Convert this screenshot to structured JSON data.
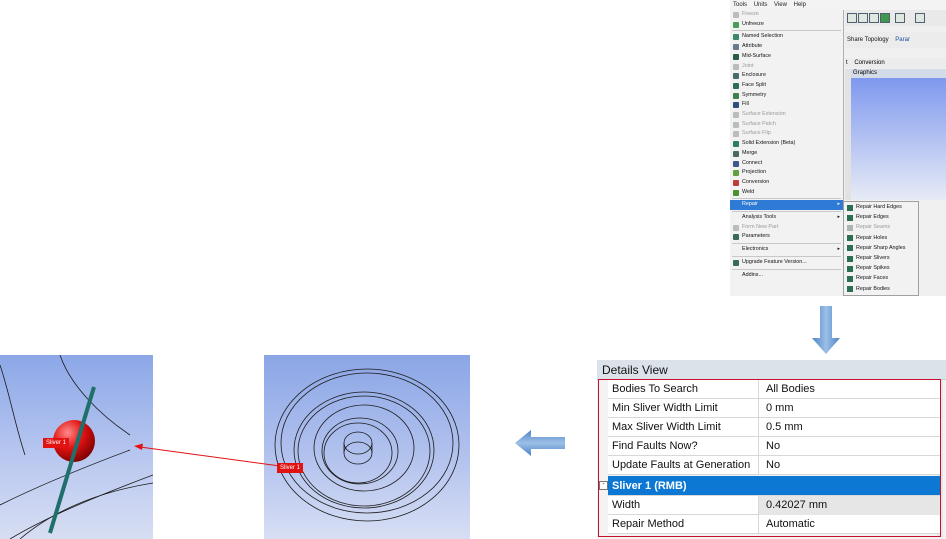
{
  "menu_screenshot": {
    "menubar": [
      "Tools",
      "Units",
      "View",
      "Help"
    ],
    "toolbar_text": "Share Topology",
    "toolbar_text2": "Parar",
    "tab_prefix": "t",
    "tab_conversion": "Conversion",
    "graphics_tab": "Graphics",
    "tools_menu": [
      {
        "label": "Freeze",
        "disabled": true,
        "icon": "freeze-icon"
      },
      {
        "label": "Unfreeze",
        "disabled": false,
        "icon": "unfreeze-icon"
      },
      {
        "label": "Named Selection",
        "disabled": false,
        "icon": "named-selection-icon"
      },
      {
        "label": "Attribute",
        "disabled": false,
        "icon": "attribute-icon"
      },
      {
        "label": "Mid-Surface",
        "disabled": false,
        "icon": "mid-surface-icon"
      },
      {
        "label": "Joint",
        "disabled": true,
        "icon": "joint-icon"
      },
      {
        "label": "Enclosure",
        "disabled": false,
        "icon": "enclosure-icon"
      },
      {
        "label": "Face Split",
        "disabled": false,
        "icon": "face-split-icon"
      },
      {
        "label": "Symmetry",
        "disabled": false,
        "icon": "symmetry-icon"
      },
      {
        "label": "Fill",
        "disabled": false,
        "icon": "fill-icon"
      },
      {
        "label": "Surface Extension",
        "disabled": true,
        "icon": "surface-extension-icon"
      },
      {
        "label": "Surface Patch",
        "disabled": true,
        "icon": "surface-patch-icon"
      },
      {
        "label": "Surface Flip",
        "disabled": true,
        "icon": "surface-flip-icon"
      },
      {
        "label": "Solid Extension (Beta)",
        "disabled": false,
        "icon": "solid-extension-icon"
      },
      {
        "label": "Merge",
        "disabled": false,
        "icon": "merge-icon"
      },
      {
        "label": "Connect",
        "disabled": false,
        "icon": "connect-icon"
      },
      {
        "label": "Projection",
        "disabled": false,
        "icon": "projection-icon"
      },
      {
        "label": "Conversion",
        "disabled": false,
        "icon": "conversion-icon"
      },
      {
        "label": "Weld",
        "disabled": false,
        "icon": "weld-icon"
      },
      {
        "label": "Repair",
        "disabled": false,
        "selected": true,
        "submenu": true
      },
      {
        "label": "Analysis Tools",
        "disabled": false,
        "submenu": true
      },
      {
        "label": "Form New Part",
        "disabled": true,
        "icon": "form-new-part-icon"
      },
      {
        "label": "Parameters",
        "disabled": false,
        "icon": "parameters-icon"
      },
      {
        "label": "Electronics",
        "disabled": false,
        "submenu": true
      },
      {
        "label": "Upgrade Feature Version...",
        "disabled": false,
        "icon": "upgrade-icon"
      },
      {
        "label": "Addins...",
        "disabled": false
      }
    ],
    "repair_submenu": [
      {
        "label": "Repair Hard Edges",
        "disabled": false
      },
      {
        "label": "Repair Edges",
        "disabled": false
      },
      {
        "label": "Repair Seams",
        "disabled": true
      },
      {
        "label": "Repair Holes",
        "disabled": false
      },
      {
        "label": "Repair Sharp Angles",
        "disabled": false
      },
      {
        "label": "Repair Slivers",
        "disabled": false
      },
      {
        "label": "Repair Spikes",
        "disabled": false
      },
      {
        "label": "Repair Faces",
        "disabled": false
      },
      {
        "label": "Repair Bodies",
        "disabled": false
      }
    ]
  },
  "details_view": {
    "title": "Details View",
    "rows": [
      {
        "key": "Bodies To Search",
        "value": "All Bodies"
      },
      {
        "key": "Min Sliver Width Limit",
        "value": "0 mm"
      },
      {
        "key": "Max Sliver Width Limit",
        "value": "0.5 mm"
      },
      {
        "key": "Find Faults Now?",
        "value": "No"
      },
      {
        "key": "Update Faults at Generation",
        "value": "No"
      }
    ],
    "group_row": "Sliver 1 (RMB)",
    "group_toggle": "-",
    "rows2": [
      {
        "key": "Width",
        "value": "0.42027 mm"
      },
      {
        "key": "Repair Method",
        "value": "Automatic"
      }
    ]
  },
  "viewport_middle": {
    "tag": "Sliver 1"
  },
  "viewport_left": {
    "tag": "Sliver 1"
  },
  "colors": {
    "accent_red": "#e21212",
    "selection_blue": "#0c78d4",
    "menu_highlight": "#2f7ad5",
    "arrow_blue": "#6b9bd2",
    "sliver_green": "#1f6f6a"
  }
}
